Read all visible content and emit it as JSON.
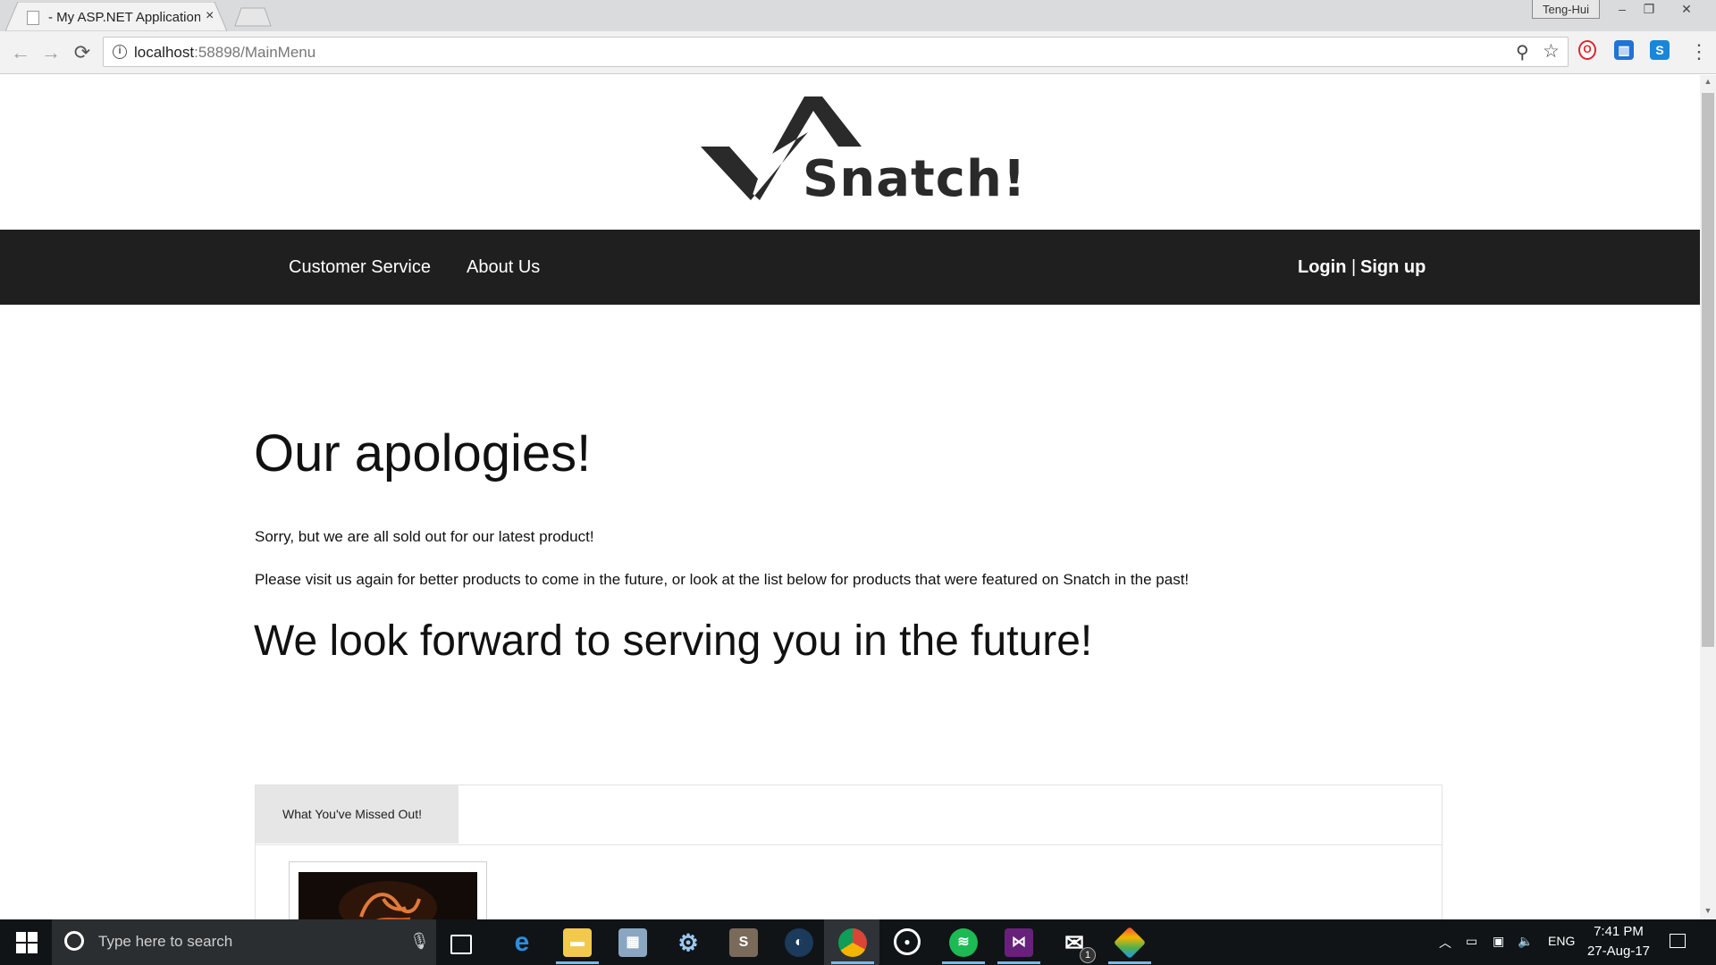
{
  "browser": {
    "tab_title": "- My ASP.NET Application",
    "tab_close": "×",
    "window_user": "Teng-Hui",
    "window_buttons": {
      "minimize": "–",
      "restore": "❐",
      "close": "✕"
    },
    "url_host": "localhost",
    "url_path": ":58898/MainMenu",
    "nav": {
      "back": "←",
      "forward": "→",
      "reload": "⟳"
    },
    "right_icons": {
      "zoom": "⚲",
      "bookmark": "☆",
      "menu": "⋮"
    },
    "extensions": [
      {
        "name": "opera-icon",
        "glyph": "O",
        "color": "#e0232e"
      },
      {
        "name": "trello-icon",
        "glyph": "▥",
        "color": "#1f74d4"
      },
      {
        "name": "skype-icon",
        "glyph": "S",
        "color": "#1a86d8"
      }
    ]
  },
  "site": {
    "logo_text": "Snatch!",
    "nav_items": [
      "Customer Service",
      "About Us"
    ],
    "auth": {
      "login": "Login",
      "divider": "|",
      "signup": "Sign up"
    }
  },
  "content": {
    "heading": "Our apologies!",
    "para1": "Sorry, but we are all sold out for our latest product!",
    "para2": "Please visit us again for better products to come in the future, or look at the list below for products that were featured on Snatch in the past!",
    "subheading": "We look forward to serving you in the future!",
    "panel_tab": "What You've Missed Out!"
  },
  "taskbar": {
    "search_placeholder": "Type here to search",
    "mic_icon": "🎙",
    "time": "7:41 PM",
    "date": "27-Aug-17",
    "language": "ENG",
    "mail_badge": "1",
    "accent": "#76b9ed"
  }
}
